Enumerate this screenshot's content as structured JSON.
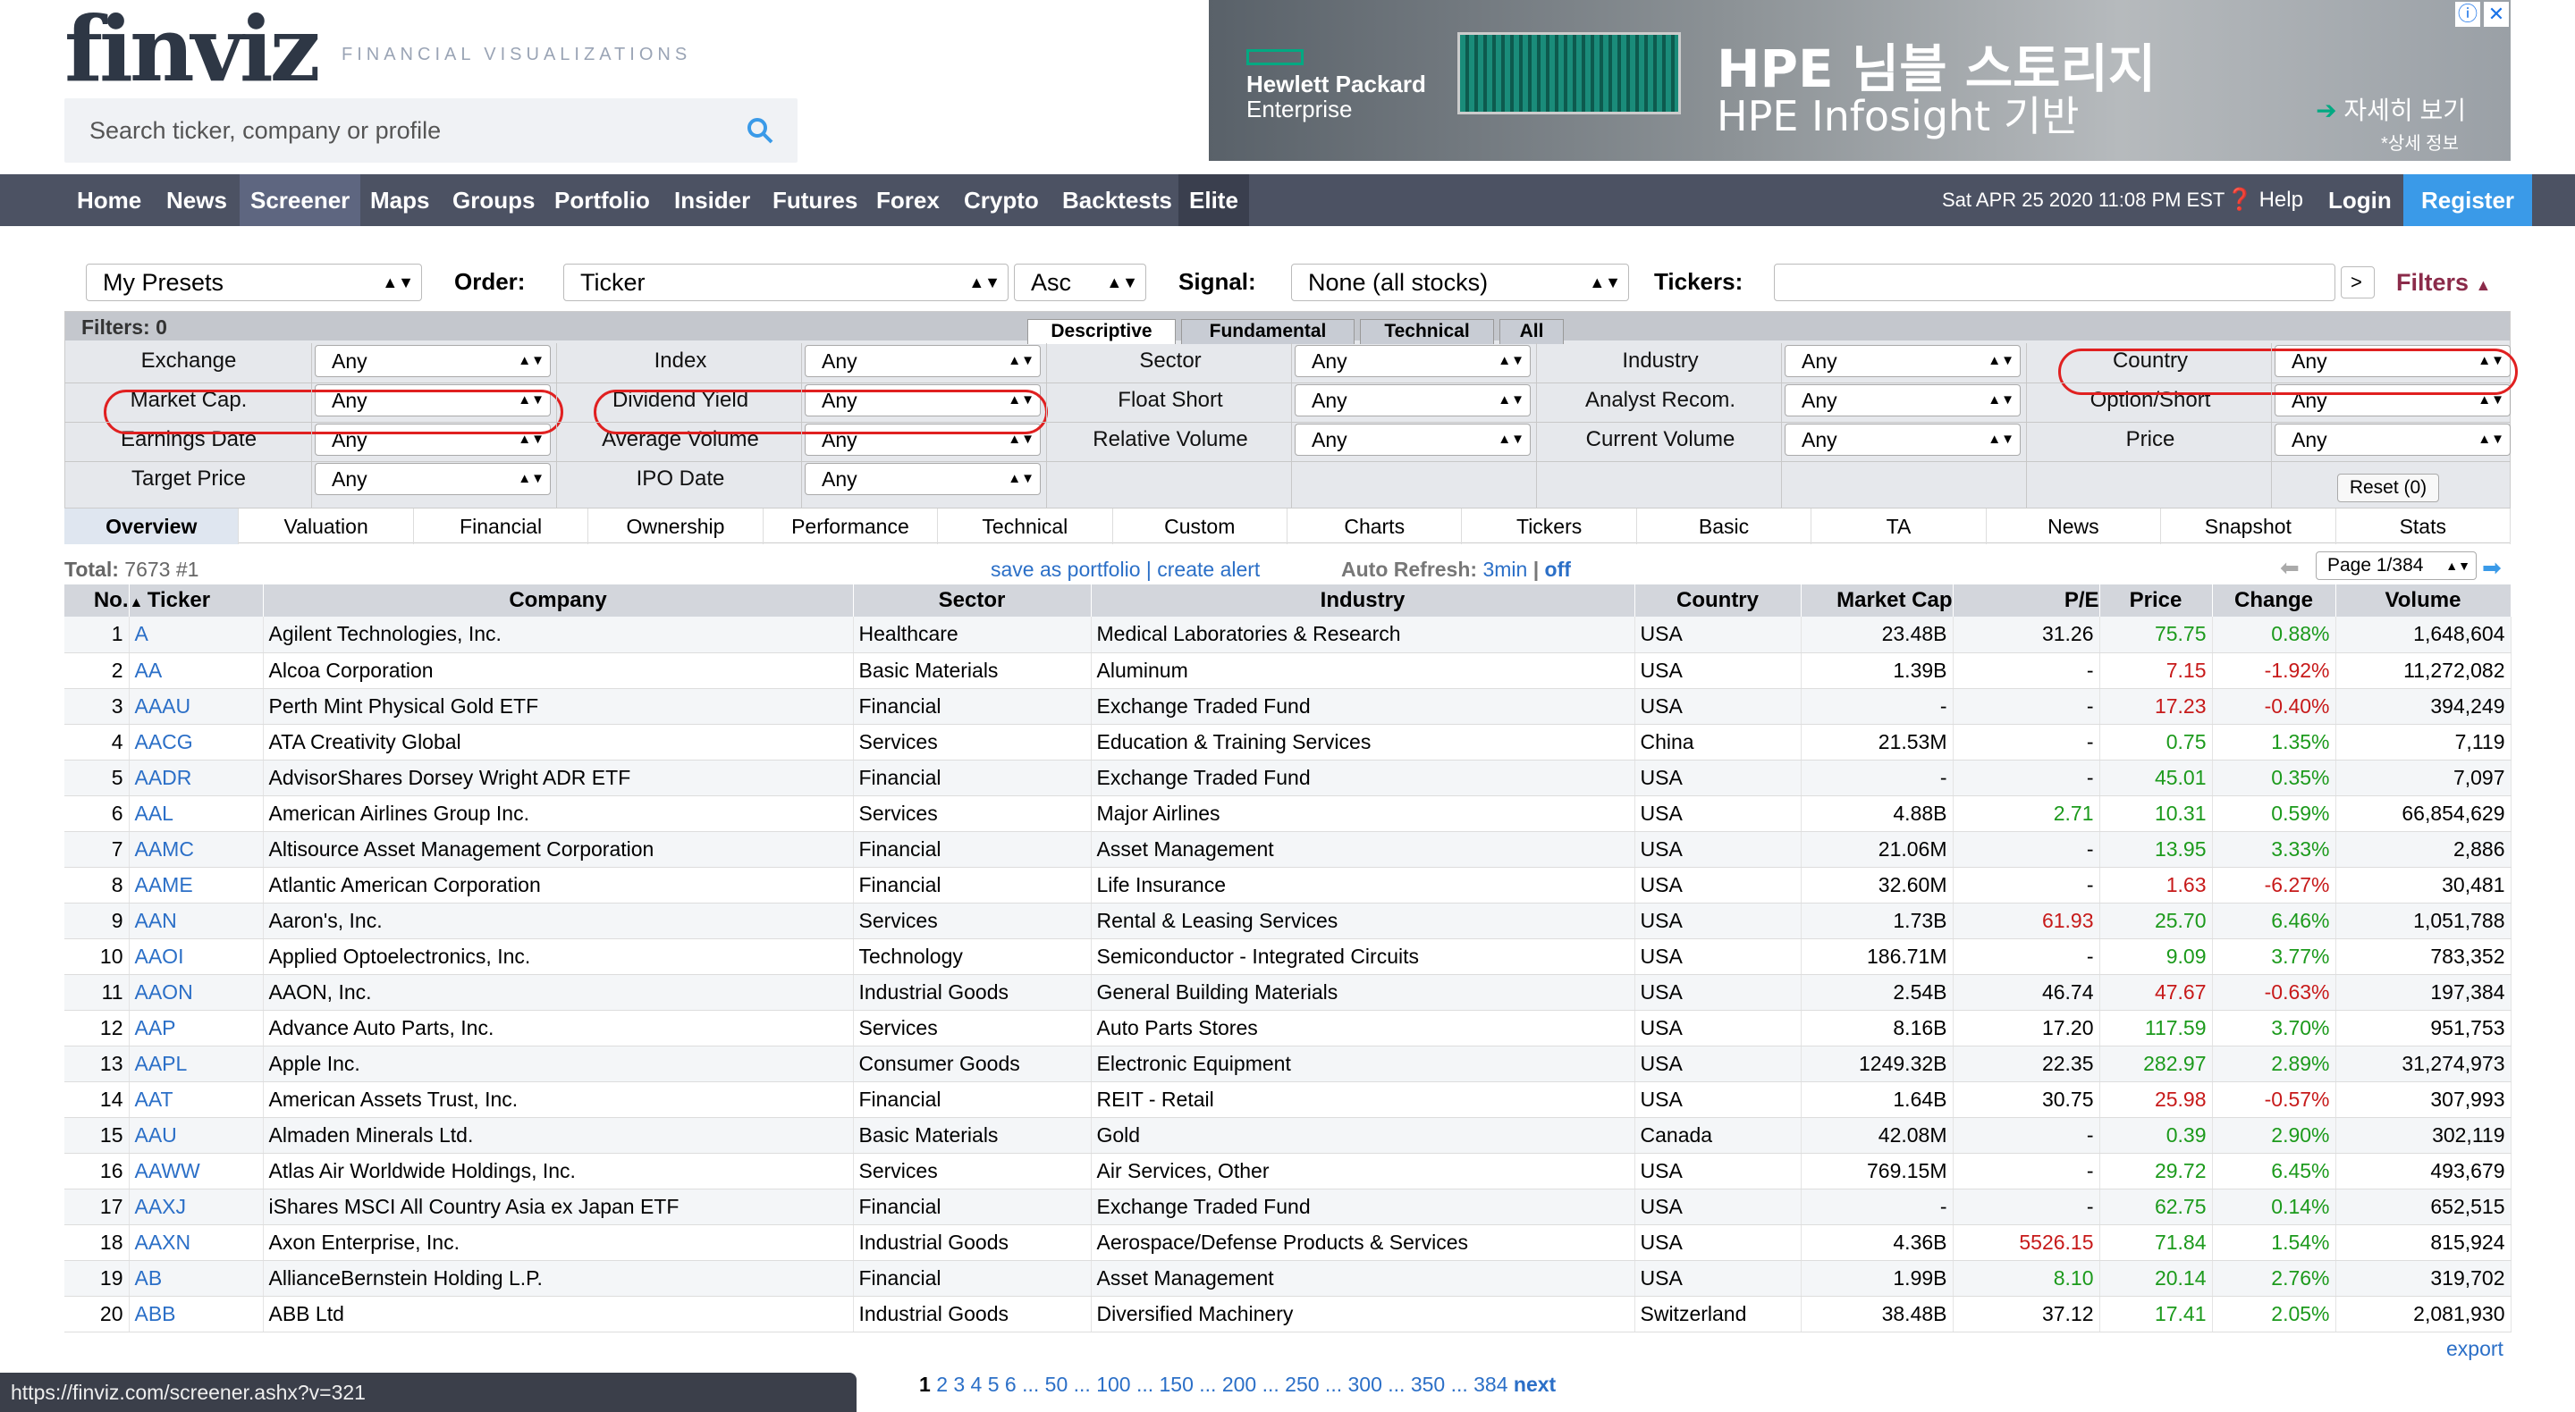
{
  "header": {
    "logo": "finviz",
    "tagline": "FINANCIAL VISUALIZATIONS",
    "search_placeholder": "Search ticker, company or profile"
  },
  "ad": {
    "brand_line1": "Hewlett Packard",
    "brand_line2": "Enterprise",
    "headline1": "HPE 님블 스토리지",
    "headline2": "HPE Infosight 기반",
    "cta": "자세히 보기",
    "cta_sub": "*상세 정보"
  },
  "nav": {
    "items": [
      "Home",
      "News",
      "Screener",
      "Maps",
      "Groups",
      "Portfolio",
      "Insider",
      "Futures",
      "Forex",
      "Crypto",
      "Backtests",
      "Elite"
    ],
    "datetime": "Sat APR 25 2020 11:08 PM EST",
    "help": "Help",
    "login": "Login",
    "register": "Register"
  },
  "controls": {
    "presets": "My Presets",
    "order_label": "Order:",
    "order_value": "Ticker",
    "direction": "Asc",
    "signal_label": "Signal:",
    "signal_value": "None (all stocks)",
    "tickers_label": "Tickers:",
    "go": ">",
    "filters_btn": "Filters"
  },
  "filters": {
    "count_label": "Filters: 0",
    "tabs": [
      "Descriptive",
      "Fundamental",
      "Technical",
      "All"
    ],
    "rows": [
      [
        {
          "label": "Exchange",
          "value": "Any"
        },
        {
          "label": "Index",
          "value": "Any"
        },
        {
          "label": "Sector",
          "value": "Any"
        },
        {
          "label": "Industry",
          "value": "Any"
        },
        {
          "label": "Country",
          "value": "Any"
        }
      ],
      [
        {
          "label": "Market Cap.",
          "value": "Any"
        },
        {
          "label": "Dividend Yield",
          "value": "Any"
        },
        {
          "label": "Float Short",
          "value": "Any"
        },
        {
          "label": "Analyst Recom.",
          "value": "Any"
        },
        {
          "label": "Option/Short",
          "value": "Any"
        }
      ],
      [
        {
          "label": "Earnings Date",
          "value": "Any"
        },
        {
          "label": "Average Volume",
          "value": "Any"
        },
        {
          "label": "Relative Volume",
          "value": "Any"
        },
        {
          "label": "Current Volume",
          "value": "Any"
        },
        {
          "label": "Price",
          "value": "Any"
        }
      ],
      [
        {
          "label": "Target Price",
          "value": "Any"
        },
        {
          "label": "IPO Date",
          "value": "Any"
        }
      ]
    ],
    "reset": "Reset (0)"
  },
  "view_tabs": [
    "Overview",
    "Valuation",
    "Financial",
    "Ownership",
    "Performance",
    "Technical",
    "Custom",
    "Charts",
    "Tickers",
    "Basic",
    "TA",
    "News",
    "Snapshot",
    "Stats"
  ],
  "summary": {
    "total": "Total:",
    "total_value": "7673 #1",
    "save_portfolio": "save as portfolio",
    "separator": "|",
    "create_alert": "create alert",
    "auto_refresh": "Auto Refresh:",
    "refresh_interval": "3min",
    "refresh_off": "off",
    "page": "Page 1/384"
  },
  "table": {
    "headers": [
      "No.",
      "Ticker",
      "Company",
      "Sector",
      "Industry",
      "Country",
      "Market Cap",
      "P/E",
      "Price",
      "Change",
      "Volume"
    ],
    "rows": [
      [
        "1",
        "A",
        "Agilent Technologies, Inc.",
        "Healthcare",
        "Medical Laboratories & Research",
        "USA",
        "23.48B",
        "31.26",
        "75.75",
        "0.88%",
        "1,648,604"
      ],
      [
        "2",
        "AA",
        "Alcoa Corporation",
        "Basic Materials",
        "Aluminum",
        "USA",
        "1.39B",
        "-",
        "7.15",
        "-1.92%",
        "11,272,082"
      ],
      [
        "3",
        "AAAU",
        "Perth Mint Physical Gold ETF",
        "Financial",
        "Exchange Traded Fund",
        "USA",
        "-",
        "-",
        "17.23",
        "-0.40%",
        "394,249"
      ],
      [
        "4",
        "AACG",
        "ATA Creativity Global",
        "Services",
        "Education & Training Services",
        "China",
        "21.53M",
        "-",
        "0.75",
        "1.35%",
        "7,119"
      ],
      [
        "5",
        "AADR",
        "AdvisorShares Dorsey Wright ADR ETF",
        "Financial",
        "Exchange Traded Fund",
        "USA",
        "-",
        "-",
        "45.01",
        "0.35%",
        "7,097"
      ],
      [
        "6",
        "AAL",
        "American Airlines Group Inc.",
        "Services",
        "Major Airlines",
        "USA",
        "4.88B",
        "2.71",
        "10.31",
        "0.59%",
        "66,854,629"
      ],
      [
        "7",
        "AAMC",
        "Altisource Asset Management Corporation",
        "Financial",
        "Asset Management",
        "USA",
        "21.06M",
        "-",
        "13.95",
        "3.33%",
        "2,886"
      ],
      [
        "8",
        "AAME",
        "Atlantic American Corporation",
        "Financial",
        "Life Insurance",
        "USA",
        "32.60M",
        "-",
        "1.63",
        "-6.27%",
        "30,481"
      ],
      [
        "9",
        "AAN",
        "Aaron's, Inc.",
        "Services",
        "Rental & Leasing Services",
        "USA",
        "1.73B",
        "61.93",
        "25.70",
        "6.46%",
        "1,051,788"
      ],
      [
        "10",
        "AAOI",
        "Applied Optoelectronics, Inc.",
        "Technology",
        "Semiconductor - Integrated Circuits",
        "USA",
        "186.71M",
        "-",
        "9.09",
        "3.77%",
        "783,352"
      ],
      [
        "11",
        "AAON",
        "AAON, Inc.",
        "Industrial Goods",
        "General Building Materials",
        "USA",
        "2.54B",
        "46.74",
        "47.67",
        "-0.63%",
        "197,384"
      ],
      [
        "12",
        "AAP",
        "Advance Auto Parts, Inc.",
        "Services",
        "Auto Parts Stores",
        "USA",
        "8.16B",
        "17.20",
        "117.59",
        "3.70%",
        "951,753"
      ],
      [
        "13",
        "AAPL",
        "Apple Inc.",
        "Consumer Goods",
        "Electronic Equipment",
        "USA",
        "1249.32B",
        "22.35",
        "282.97",
        "2.89%",
        "31,274,973"
      ],
      [
        "14",
        "AAT",
        "American Assets Trust, Inc.",
        "Financial",
        "REIT - Retail",
        "USA",
        "1.64B",
        "30.75",
        "25.98",
        "-0.57%",
        "307,993"
      ],
      [
        "15",
        "AAU",
        "Almaden Minerals Ltd.",
        "Basic Materials",
        "Gold",
        "Canada",
        "42.08M",
        "-",
        "0.39",
        "2.90%",
        "302,119"
      ],
      [
        "16",
        "AAWW",
        "Atlas Air Worldwide Holdings, Inc.",
        "Services",
        "Air Services, Other",
        "USA",
        "769.15M",
        "-",
        "29.72",
        "6.45%",
        "493,679"
      ],
      [
        "17",
        "AAXJ",
        "iShares MSCI All Country Asia ex Japan ETF",
        "Financial",
        "Exchange Traded Fund",
        "USA",
        "-",
        "-",
        "62.75",
        "0.14%",
        "652,515"
      ],
      [
        "18",
        "AAXN",
        "Axon Enterprise, Inc.",
        "Industrial Goods",
        "Aerospace/Defense Products & Services",
        "USA",
        "4.36B",
        "5526.15",
        "71.84",
        "1.54%",
        "815,924"
      ],
      [
        "19",
        "AB",
        "AllianceBernstein Holding L.P.",
        "Financial",
        "Asset Management",
        "USA",
        "1.99B",
        "8.10",
        "20.14",
        "2.76%",
        "319,702"
      ],
      [
        "20",
        "ABB",
        "ABB Ltd",
        "Industrial Goods",
        "Diversified Machinery",
        "Switzerland",
        "38.48B",
        "37.12",
        "17.41",
        "2.05%",
        "2,081,930"
      ]
    ],
    "pe_colors": [
      "",
      "",
      "",
      "",
      "",
      "pos",
      "",
      "",
      "neg",
      "",
      "",
      "",
      "",
      "",
      "",
      "",
      "",
      "neg",
      "pos",
      ""
    ],
    "price_colors": [
      "pos",
      "neg",
      "neg",
      "pos",
      "pos",
      "pos",
      "pos",
      "neg",
      "pos",
      "pos",
      "neg",
      "pos",
      "pos",
      "neg",
      "pos",
      "pos",
      "pos",
      "pos",
      "pos",
      "pos"
    ]
  },
  "footer": {
    "status_url": "https://finviz.com/screener.ashx?v=321",
    "current_page": "1",
    "pages": "2 3 4 5 6 ... 50 ... 100 ... 150 ... 200 ... 250 ... 300 ... 350 ... 384",
    "next": "next",
    "export": "export"
  }
}
